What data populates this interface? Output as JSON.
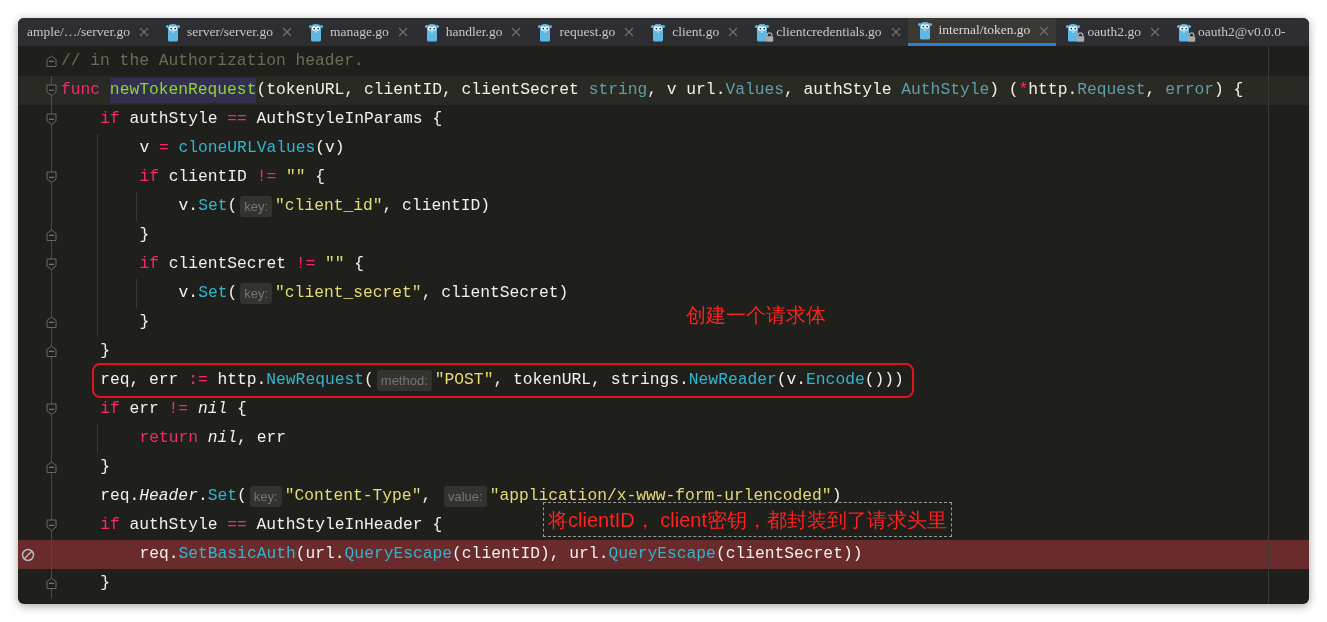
{
  "tabs": [
    {
      "label": "ample/…/server.go",
      "icon": false,
      "locked": false,
      "selected": false
    },
    {
      "label": "server/server.go",
      "icon": true,
      "locked": false,
      "selected": false
    },
    {
      "label": "manage.go",
      "icon": true,
      "locked": false,
      "selected": false
    },
    {
      "label": "handler.go",
      "icon": true,
      "locked": false,
      "selected": false
    },
    {
      "label": "request.go",
      "icon": true,
      "locked": false,
      "selected": false
    },
    {
      "label": "client.go",
      "icon": true,
      "locked": false,
      "selected": false
    },
    {
      "label": "clientcredentials.go",
      "icon": true,
      "locked": true,
      "selected": false
    },
    {
      "label": "internal/token.go",
      "icon": true,
      "locked": false,
      "selected": true
    },
    {
      "label": "oauth2.go",
      "icon": true,
      "locked": true,
      "selected": false
    },
    {
      "label": "oauth2@v0.0.0-",
      "icon": true,
      "locked": true,
      "selected": false,
      "cut": true
    }
  ],
  "code_lines": [
    {
      "kind": "fold_end",
      "tokens": [
        {
          "kind": "comment",
          "text": "// in the Authorization header."
        }
      ]
    },
    {
      "kind": "fold_start",
      "current": true,
      "tokens": [
        {
          "kind": "kw",
          "text": "func "
        },
        {
          "kind": "decl",
          "text": "newTokenRequest"
        },
        {
          "kind": "plain",
          "text": "(tokenURL, clientID, clientSecret "
        },
        {
          "kind": "type",
          "text": "string"
        },
        {
          "kind": "plain",
          "text": ", v url."
        },
        {
          "kind": "type",
          "text": "Values"
        },
        {
          "kind": "plain",
          "text": ", authStyle "
        },
        {
          "kind": "type",
          "text": "AuthStyle"
        },
        {
          "kind": "plain",
          "text": ") ("
        },
        {
          "kind": "kw",
          "text": "*"
        },
        {
          "kind": "plain",
          "text": "http."
        },
        {
          "kind": "type",
          "text": "Request"
        },
        {
          "kind": "plain",
          "text": ", "
        },
        {
          "kind": "type",
          "text": "error"
        },
        {
          "kind": "plain",
          "text": ") {"
        }
      ],
      "children": [
        {
          "kind": "fold_start",
          "tokens": [
            {
              "kind": "kw",
              "text": "if"
            },
            {
              "kind": "plain",
              "text": " authStyle "
            },
            {
              "kind": "kw",
              "text": "== "
            },
            {
              "kind": "plain",
              "text": "AuthStyleInParams {"
            }
          ],
          "children": [
            {
              "kind": "line",
              "tokens": [
                {
                  "kind": "plain",
                  "text": "v "
                },
                {
                  "kind": "kw",
                  "text": "= "
                },
                {
                  "kind": "fn",
                  "text": "cloneURLValues"
                },
                {
                  "kind": "plain",
                  "text": "(v)"
                }
              ]
            },
            {
              "kind": "fold_start",
              "tokens": [
                {
                  "kind": "kw",
                  "text": "if"
                },
                {
                  "kind": "plain",
                  "text": " clientID "
                },
                {
                  "kind": "kw",
                  "text": "!= "
                },
                {
                  "kind": "str",
                  "text": "\"\""
                },
                {
                  "kind": "plain",
                  "text": " {"
                }
              ],
              "children": [
                {
                  "kind": "line",
                  "tokens": [
                    {
                      "kind": "plain",
                      "text": "v."
                    },
                    {
                      "kind": "fn",
                      "text": "Set"
                    },
                    {
                      "kind": "plain",
                      "text": "("
                    },
                    {
                      "kind": "hint",
                      "text": "key:"
                    },
                    {
                      "kind": "str",
                      "text": "\"client_id\""
                    },
                    {
                      "kind": "plain",
                      "text": ", clientID)"
                    }
                  ]
                }
              ]
            },
            {
              "kind": "fold_end",
              "tokens": [
                {
                  "kind": "plain",
                  "text": "}"
                }
              ]
            },
            {
              "kind": "fold_start",
              "tokens": [
                {
                  "kind": "kw",
                  "text": "if"
                },
                {
                  "kind": "plain",
                  "text": " clientSecret "
                },
                {
                  "kind": "kw",
                  "text": "!= "
                },
                {
                  "kind": "str",
                  "text": "\"\""
                },
                {
                  "kind": "plain",
                  "text": " {"
                }
              ],
              "children": [
                {
                  "kind": "line",
                  "tokens": [
                    {
                      "kind": "plain",
                      "text": "v."
                    },
                    {
                      "kind": "fn",
                      "text": "Set"
                    },
                    {
                      "kind": "plain",
                      "text": "("
                    },
                    {
                      "kind": "hint",
                      "text": "key:"
                    },
                    {
                      "kind": "str",
                      "text": "\"client_secret\""
                    },
                    {
                      "kind": "plain",
                      "text": ", clientSecret)"
                    }
                  ]
                }
              ]
            },
            {
              "kind": "fold_end",
              "tokens": [
                {
                  "kind": "plain",
                  "text": "}"
                }
              ],
              "note": {
                "kind": "plain",
                "text": "创建一个请求体"
              }
            }
          ]
        },
        {
          "kind": "fold_end",
          "tokens": [
            {
              "kind": "plain",
              "text": "}"
            }
          ]
        },
        {
          "kind": "line",
          "framed": true,
          "tokens": [
            {
              "kind": "plain",
              "text": "req, err "
            },
            {
              "kind": "kw",
              "text": ":="
            },
            {
              "kind": "plain",
              "text": " http."
            },
            {
              "kind": "fn",
              "text": "NewRequest"
            },
            {
              "kind": "plain",
              "text": "("
            },
            {
              "kind": "hint",
              "text": "method:"
            },
            {
              "kind": "str",
              "text": "\"POST\""
            },
            {
              "kind": "plain",
              "text": ", tokenURL, strings."
            },
            {
              "kind": "fn",
              "text": "NewReader"
            },
            {
              "kind": "plain",
              "text": "(v."
            },
            {
              "kind": "fn",
              "text": "Encode"
            },
            {
              "kind": "plain",
              "text": "()))"
            }
          ]
        },
        {
          "kind": "fold_start",
          "tokens": [
            {
              "kind": "kw",
              "text": "if"
            },
            {
              "kind": "plain",
              "text": " err "
            },
            {
              "kind": "kw",
              "text": "!= "
            },
            {
              "kind": "italic",
              "text": "nil"
            },
            {
              "kind": "plain",
              "text": " {"
            }
          ],
          "children": [
            {
              "kind": "line",
              "tokens": [
                {
                  "kind": "kw",
                  "text": "return "
                },
                {
                  "kind": "italic",
                  "text": "nil"
                },
                {
                  "kind": "plain",
                  "text": ", err"
                }
              ]
            }
          ]
        },
        {
          "kind": "fold_end",
          "tokens": [
            {
              "kind": "plain",
              "text": "}"
            }
          ]
        },
        {
          "kind": "line",
          "tokens": [
            {
              "kind": "plain",
              "text": "req."
            },
            {
              "kind": "italic",
              "text": "Header"
            },
            {
              "kind": "plain",
              "text": "."
            },
            {
              "kind": "fn",
              "text": "Set"
            },
            {
              "kind": "plain",
              "text": "("
            },
            {
              "kind": "hint",
              "text": "key:"
            },
            {
              "kind": "str",
              "text": "\"Content-Type\""
            },
            {
              "kind": "plain",
              "text": ", "
            },
            {
              "kind": "hint",
              "text": "value:"
            },
            {
              "kind": "str",
              "text": "\"application/x-www-form-urlencoded\""
            },
            {
              "kind": "plain",
              "text": ")"
            }
          ]
        },
        {
          "kind": "fold_start",
          "tokens": [
            {
              "kind": "kw",
              "text": "if"
            },
            {
              "kind": "plain",
              "text": " authStyle "
            },
            {
              "kind": "kw",
              "text": "== "
            },
            {
              "kind": "plain",
              "text": "AuthStyleInHeader {"
            }
          ],
          "note": {
            "kind": "dashed",
            "text": "将clientID， client密钥，都封装到了请求头里"
          },
          "children": [
            {
              "kind": "line",
              "breakpoint": true,
              "tokens": [
                {
                  "kind": "plain",
                  "text": "req."
                },
                {
                  "kind": "fn",
                  "text": "SetBasicAuth"
                },
                {
                  "kind": "plain",
                  "text": "(url."
                },
                {
                  "kind": "fn",
                  "text": "QueryEscape"
                },
                {
                  "kind": "plain",
                  "text": "(clientID), url."
                },
                {
                  "kind": "fn",
                  "text": "QueryEscape"
                },
                {
                  "kind": "plain",
                  "text": "(clientSecret))"
                }
              ]
            }
          ]
        },
        {
          "kind": "fold_end",
          "tokens": [
            {
              "kind": "plain",
              "text": "}"
            }
          ]
        }
      ]
    }
  ]
}
